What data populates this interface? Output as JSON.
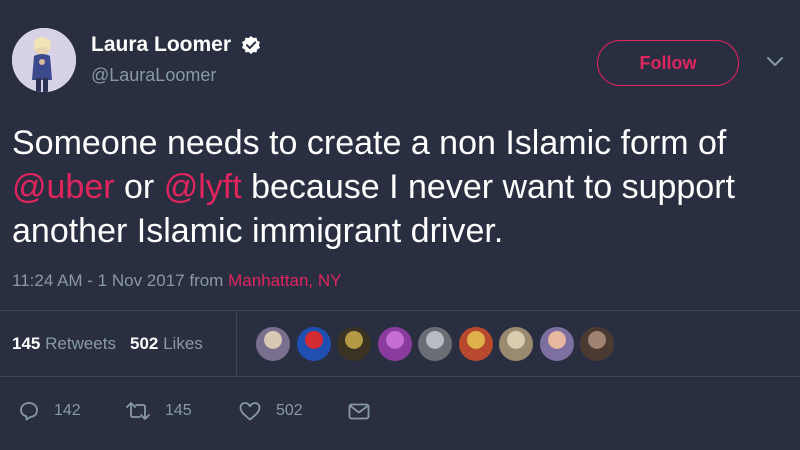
{
  "author": {
    "display_name": "Laura Loomer",
    "handle": "@LauraLoomer",
    "verified": true
  },
  "follow_button": {
    "label": "Follow"
  },
  "tweet": {
    "parts": [
      {
        "text": "Someone needs to create a non Islamic form of ",
        "mention": false
      },
      {
        "text": "@uber",
        "mention": true
      },
      {
        "text": " or ",
        "mention": false
      },
      {
        "text": "@lyft",
        "mention": true
      },
      {
        "text": " because I never want to support another Islamic immigrant driver.",
        "mention": false
      }
    ]
  },
  "meta": {
    "timestamp": "11:24 AM - 1 Nov 2017",
    "from_label": " from ",
    "location": "Manhattan, NY"
  },
  "stats": {
    "retweets_count": "145",
    "retweets_label": "Retweets",
    "likes_count": "502",
    "likes_label": "Likes"
  },
  "likers": [
    {
      "name": "liker-1",
      "colors": [
        "#7a6f8f",
        "#d8c8b4"
      ]
    },
    {
      "name": "liker-2",
      "colors": [
        "#1f4fb0",
        "#d42a34"
      ]
    },
    {
      "name": "liker-3",
      "colors": [
        "#3a3324",
        "#b59a45"
      ]
    },
    {
      "name": "liker-4",
      "colors": [
        "#8a3b9e",
        "#c56fd4"
      ]
    },
    {
      "name": "liker-5",
      "colors": [
        "#6a6e74",
        "#b8bcc2"
      ]
    },
    {
      "name": "liker-6",
      "colors": [
        "#b8492f",
        "#e0b14a"
      ]
    },
    {
      "name": "liker-7",
      "colors": [
        "#9a8a70",
        "#d9cdb0"
      ]
    },
    {
      "name": "liker-8",
      "colors": [
        "#7d6fa0",
        "#e8b7a0"
      ]
    },
    {
      "name": "liker-9",
      "colors": [
        "#4a3a32",
        "#a08272"
      ]
    }
  ],
  "actions": {
    "reply_count": "142",
    "retweet_count": "145",
    "like_count": "502"
  },
  "colors": {
    "background": "#292f40",
    "accent": "#e0245e",
    "muted_text": "#8899a6"
  }
}
